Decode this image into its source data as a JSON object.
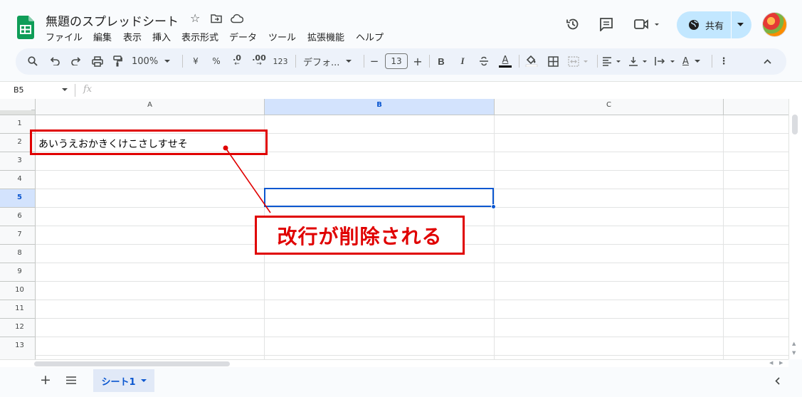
{
  "doc": {
    "title": "無題のスプレッドシート"
  },
  "menu": [
    "ファイル",
    "編集",
    "表示",
    "挿入",
    "表示形式",
    "データ",
    "ツール",
    "拡張機能",
    "ヘルプ"
  ],
  "header": {
    "share_label": "共有"
  },
  "toolbar": {
    "zoom": "100%",
    "currency": "¥",
    "percent": "%",
    "dec_decrease": ".0",
    "dec_increase": ".00",
    "format_123": "123",
    "font": "デフォ...",
    "font_size": "13",
    "bold": "B",
    "italic": "I",
    "text_color": "A",
    "text_rotate": "A"
  },
  "formula": {
    "cell_ref": "B5",
    "fx": "fx",
    "value": ""
  },
  "columns": [
    "A",
    "B",
    "C"
  ],
  "rows": [
    "1",
    "2",
    "3",
    "4",
    "5",
    "6",
    "7",
    "8",
    "9",
    "10",
    "11",
    "12",
    "13"
  ],
  "cells": {
    "A2": "あいうえおかきくけこさしすせそ",
    "B5": ""
  },
  "selected_cell": "B5",
  "annotation": {
    "text": "改行が削除される",
    "color": "#e00000"
  },
  "sheets": [
    {
      "name": "シート1",
      "active": true
    }
  ],
  "colors": {
    "accent": "#0b57d0",
    "share_bg": "#c2e7ff",
    "selected_header": "#d3e3fd",
    "sheets_green": "#0f9d58"
  }
}
